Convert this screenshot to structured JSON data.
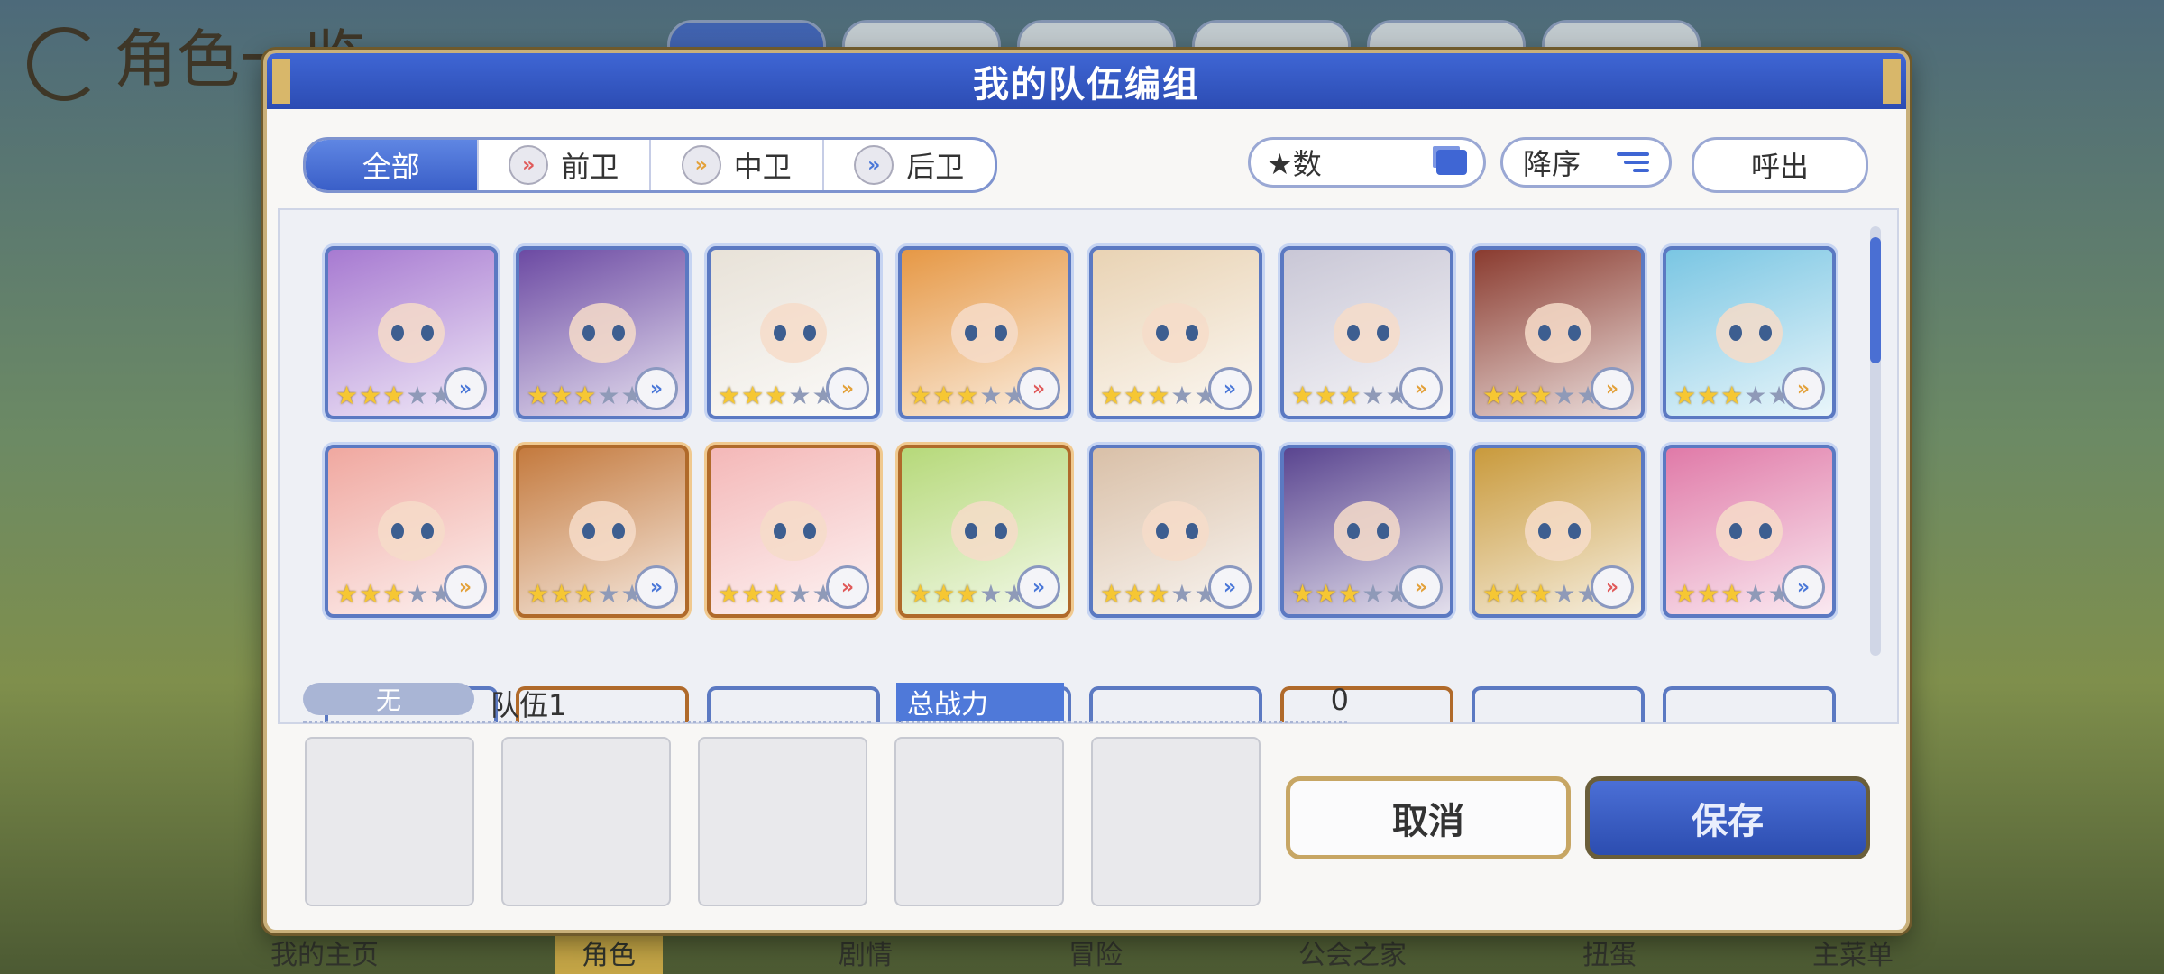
{
  "background": {
    "title": "角色一览",
    "nav": [
      "我的主页",
      "角色",
      "剧情",
      "冒险",
      "公会之家",
      "扭蛋",
      "主菜单"
    ]
  },
  "dialog": {
    "title": "我的队伍编组",
    "filters": [
      {
        "label": "全部",
        "icon": null,
        "active": true
      },
      {
        "label": "前卫",
        "icon": "front-position-icon"
      },
      {
        "label": "中卫",
        "icon": "middle-position-icon"
      },
      {
        "label": "后卫",
        "icon": "back-position-icon"
      }
    ],
    "sort": {
      "label": "★数",
      "icon": "copy-icon"
    },
    "order": {
      "label": "降序",
      "icon": "sort-lines-icon"
    },
    "call_label": "呼出",
    "team": {
      "badge": "无",
      "name": "队伍1",
      "power_label": "总战力",
      "power_value": "0",
      "slot_count": 5
    },
    "cancel_label": "取消",
    "save_label": "保存"
  },
  "roster": [
    {
      "stars": 3,
      "position": "back",
      "bg": "#a77ad1",
      "gold": false
    },
    {
      "stars": 3,
      "position": "back",
      "bg": "#6c4aa3",
      "gold": false
    },
    {
      "stars": 3,
      "position": "middle",
      "bg": "#e8e2d8",
      "gold": false
    },
    {
      "stars": 3,
      "position": "front",
      "bg": "#e69845",
      "gold": false
    },
    {
      "stars": 3,
      "position": "back",
      "bg": "#e9d3b4",
      "gold": false
    },
    {
      "stars": 3,
      "position": "middle",
      "bg": "#c9c7d6",
      "gold": false
    },
    {
      "stars": 3,
      "position": "middle",
      "bg": "#8a3b2f",
      "gold": false
    },
    {
      "stars": 3,
      "position": "middle",
      "bg": "#7ac6e3",
      "gold": false
    },
    {
      "stars": 3,
      "position": "middle",
      "bg": "#f0a8a0",
      "gold": false
    },
    {
      "stars": 3,
      "position": "back",
      "bg": "#c47a3e",
      "gold": true
    },
    {
      "stars": 3,
      "position": "front",
      "bg": "#f4b8b8",
      "gold": true
    },
    {
      "stars": 3,
      "position": "back",
      "bg": "#b6d97a",
      "gold": true
    },
    {
      "stars": 3,
      "position": "back",
      "bg": "#d9c0a8",
      "gold": false
    },
    {
      "stars": 3,
      "position": "middle",
      "bg": "#5a4590",
      "gold": false
    },
    {
      "stars": 3,
      "position": "front",
      "bg": "#c99a3c",
      "gold": false
    },
    {
      "stars": 3,
      "position": "back",
      "bg": "#e07aa8",
      "gold": false
    }
  ],
  "colors": {
    "accent": "#3f66d4",
    "frame_gold": "#c9b07a",
    "star_on": "#f6c733",
    "star_off": "#8f9ab8"
  }
}
